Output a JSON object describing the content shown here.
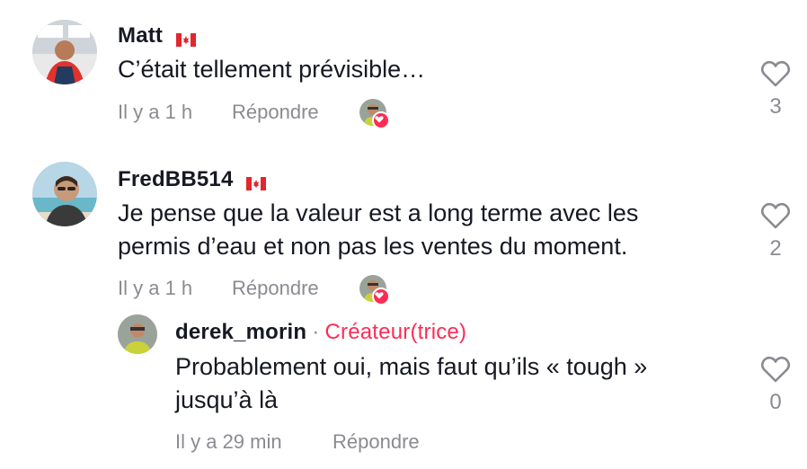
{
  "comments": [
    {
      "username": "Matt",
      "flag": "canada-flag",
      "text": "C’était tellement prévisible…",
      "time": "Il y a 1 h",
      "reply_label": "Répondre",
      "likes": "3"
    },
    {
      "username": "FredBB514",
      "flag": "canada-flag",
      "text_line1": "Je pense que la valeur est a long terme avec les",
      "text_line2": "permis d’eau et non pas les ventes du moment.",
      "time": "Il y a 1 h",
      "reply_label": "Répondre",
      "likes": "2"
    }
  ],
  "reply": {
    "username": "derek_morin",
    "separator": "·",
    "creator_label": "Créateur(trice)",
    "text_line1": "Probablement oui, mais faut qu’ils « tough »",
    "text_line2": "jusqu’à là",
    "time": "Il y a 29 min",
    "reply_label": "Répondre",
    "likes": "0"
  },
  "colors": {
    "accent": "#fe2c55",
    "muted": "#8a8b91",
    "text": "#161823"
  }
}
